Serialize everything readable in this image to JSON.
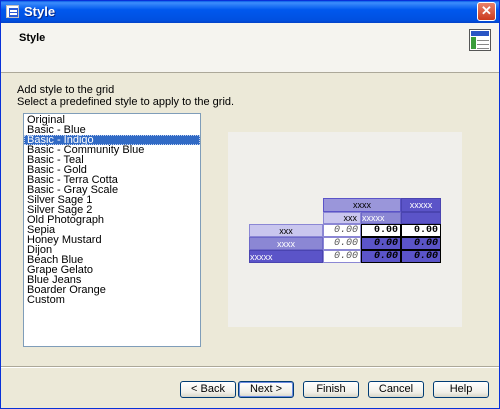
{
  "window": {
    "title": "Style",
    "close_symbol": "✕"
  },
  "header": {
    "title": "Style",
    "icon": "grid-style-icon"
  },
  "instructions": {
    "line1": "Add style to the grid",
    "line2": "Select a predefined style to apply to the grid."
  },
  "styles": {
    "selected_index": 2,
    "items": [
      "Original",
      "Basic - Blue",
      "Basic - Indigo",
      "Basic - Community Blue",
      "Basic - Teal",
      "Basic - Gold",
      "Basic - Terra Cotta",
      "Basic - Gray Scale",
      "Silver Sage 1",
      "Silver Sage 2",
      "Old Photograph",
      "Sepia",
      "Honey Mustard",
      "Dijon",
      "Beach Blue",
      "Grape Gelato",
      "Blue Jeans",
      "Boarder Orange",
      "Custom"
    ]
  },
  "preview": {
    "col_header_top": "xxxx",
    "col_header_top_right": "xxxxx",
    "col_header_sub_1": "xxx",
    "col_header_sub_2": "xxxxx",
    "row_headers": [
      "xxx",
      "xxxx",
      "xxxxx"
    ],
    "rows": [
      [
        "0.00",
        "0.00",
        "0.00"
      ],
      [
        "0.00",
        "0.00",
        "0.00"
      ],
      [
        "0.00",
        "0.00",
        "0.00"
      ]
    ]
  },
  "buttons": {
    "back": "< Back",
    "next": "Next >",
    "finish": "Finish",
    "cancel": "Cancel",
    "help": "Help"
  },
  "colors": {
    "indigo_dark": "#5b54c8",
    "indigo_mid": "#8b87d4",
    "indigo_light": "#c9c6ee",
    "selection": "#316ac5"
  }
}
